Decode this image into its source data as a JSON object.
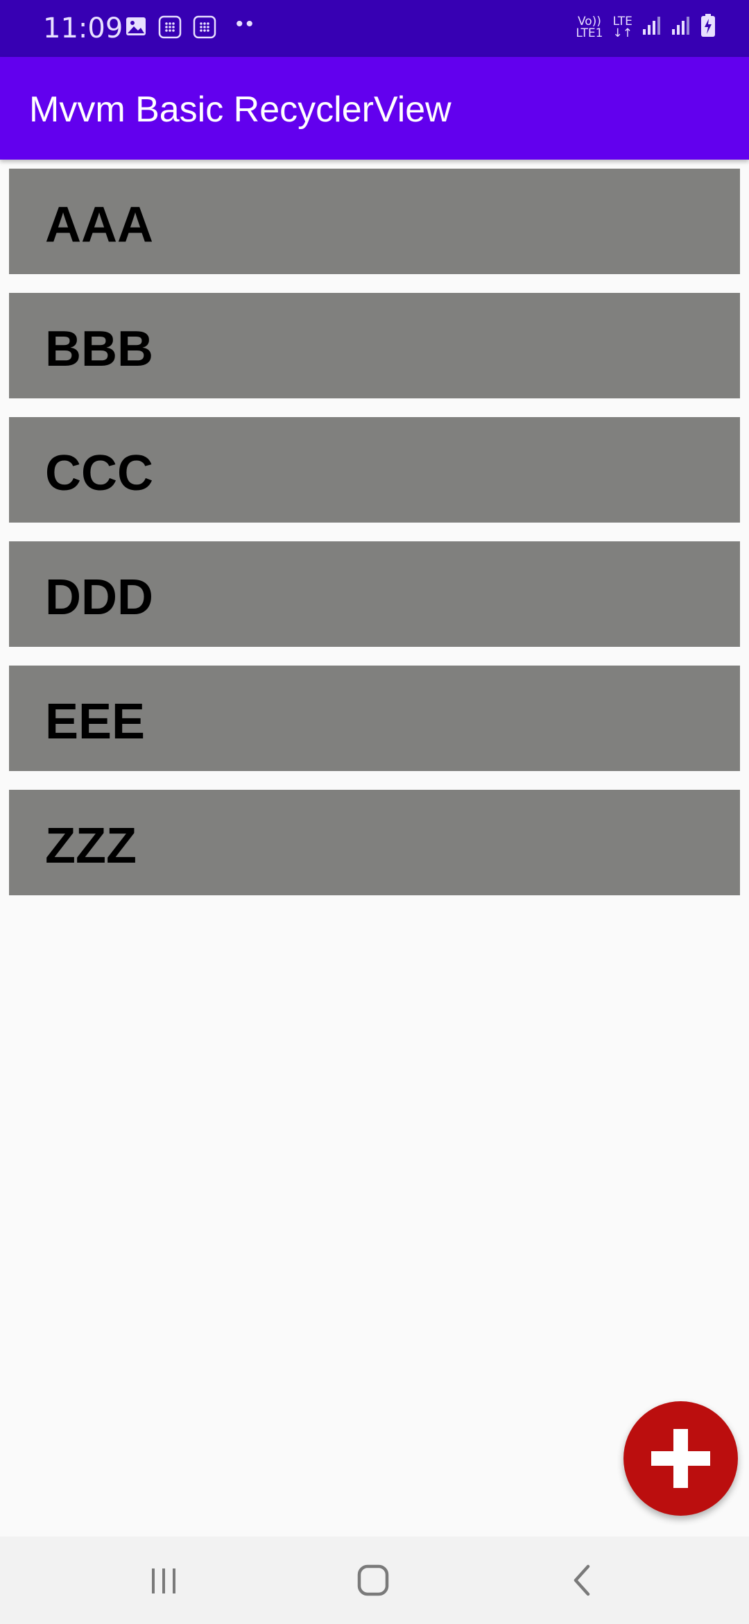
{
  "status_bar": {
    "time": "11:09",
    "dots": "••",
    "volte_top": "Vo))",
    "volte_bottom": "LTE1",
    "lte_label": "LTE",
    "lte_arrows": "↓↑",
    "icons": [
      "image-icon",
      "calendar-icon",
      "calendar-icon",
      "signal-icon",
      "signal-icon",
      "battery-charging-icon"
    ]
  },
  "app_bar": {
    "title": "Mvvm Basic RecyclerView",
    "color": "#6200ee"
  },
  "list": {
    "items": [
      {
        "label": "AAA"
      },
      {
        "label": "BBB"
      },
      {
        "label": "CCC"
      },
      {
        "label": "DDD"
      },
      {
        "label": "EEE"
      },
      {
        "label": "ZZZ"
      }
    ],
    "item_color": "#80807e"
  },
  "fab": {
    "icon": "plus-icon",
    "color": "#bb0e0e"
  },
  "nav_bar": {
    "buttons": [
      "recents-icon",
      "home-icon",
      "back-icon"
    ]
  }
}
